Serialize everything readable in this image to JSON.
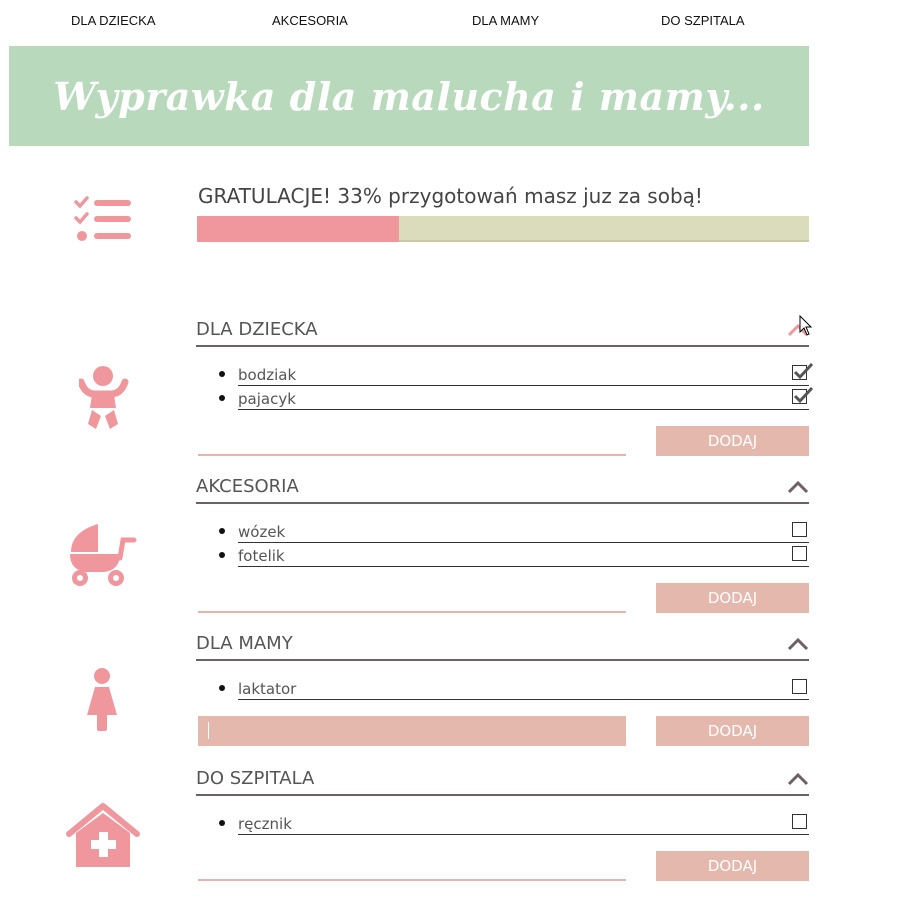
{
  "nav": {
    "items": [
      "DLA DZIECKA",
      "AKCESORIA",
      "DLA MAMY",
      "DO SZPITALA"
    ]
  },
  "banner": {
    "title": "Wyprawka dla malucha i mamy..."
  },
  "progress": {
    "message": "GRATULACJE! 33% przygotowań masz juz za sobą!",
    "value_percent": 33
  },
  "colors": {
    "accent_pink": "#ef979d",
    "banner_green": "#b8d9bb",
    "button_rose": "#e4b8ad",
    "track": "#dbdcbb"
  },
  "sections": [
    {
      "title": "DLA DZIECKA",
      "icon": "baby-icon",
      "items": [
        {
          "label": "bodziak",
          "checked": true
        },
        {
          "label": "pajacyk",
          "checked": true
        }
      ],
      "button": "DODAJ"
    },
    {
      "title": "AKCESORIA",
      "icon": "stroller-icon",
      "items": [
        {
          "label": "wózek",
          "checked": false
        },
        {
          "label": "fotelik",
          "checked": false
        }
      ],
      "button": "DODAJ"
    },
    {
      "title": "DLA MAMY",
      "icon": "woman-icon",
      "items": [
        {
          "label": "laktator",
          "checked": false
        }
      ],
      "button": "DODAJ"
    },
    {
      "title": "DO SZPITALA",
      "icon": "hospital-icon",
      "items": [
        {
          "label": "ręcznik",
          "checked": false
        }
      ],
      "button": "DODAJ"
    }
  ]
}
